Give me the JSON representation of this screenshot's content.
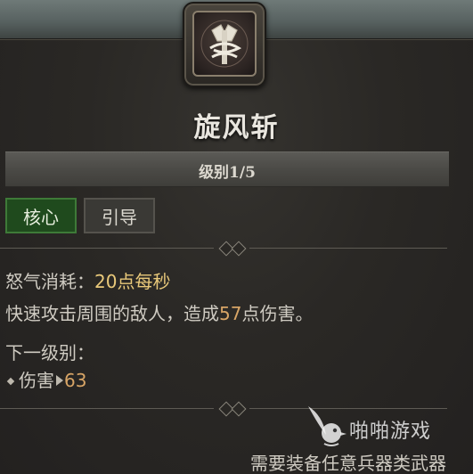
{
  "skill": {
    "icon": "whirlwind-axe-icon",
    "name": "旋风斩",
    "level": "级别1/5",
    "tags": [
      "核心",
      "引导"
    ]
  },
  "stats": {
    "cost_label": "怒气消耗：",
    "cost_value": "20点每秒",
    "desc_prefix": "快速攻击周围的敌人，造成",
    "desc_damage": "57",
    "desc_suffix": "点伤害。"
  },
  "next_level": {
    "header": "下一级别：",
    "label": "伤害",
    "value": "63"
  },
  "requirement": "需要装备任意兵器类武器",
  "watermark": {
    "icon": "bird-logo-icon",
    "text": "啪啪游戏"
  },
  "colors": {
    "highlight": "#e9c97a",
    "core_tag": "#1f4a1d",
    "panel": "#2a2825"
  }
}
